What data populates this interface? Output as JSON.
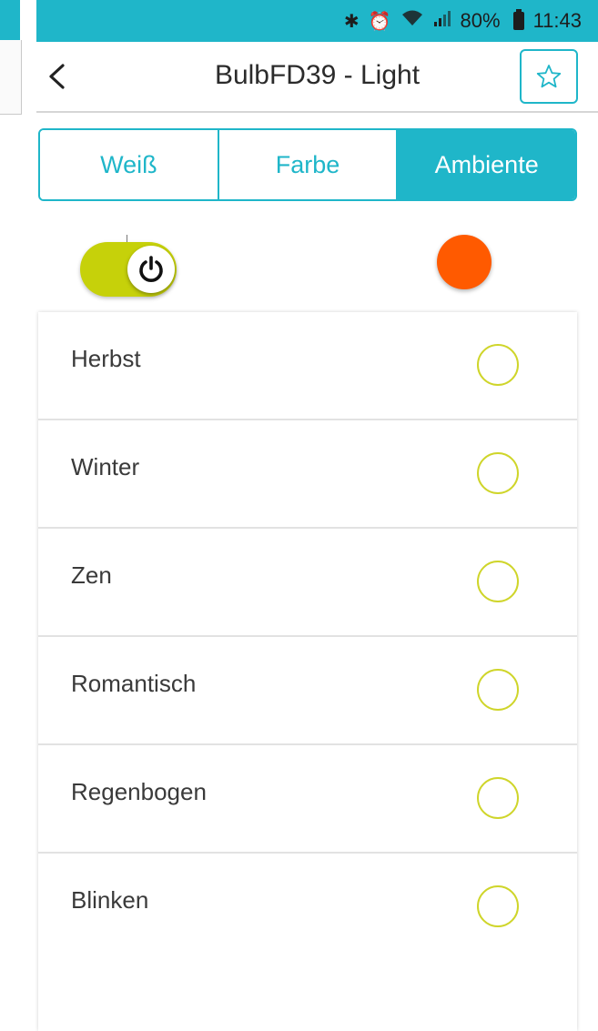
{
  "status_bar": {
    "icons": [
      "bluetooth-icon",
      "alarm-icon",
      "wifi-icon",
      "signal-icon"
    ],
    "battery": "80%",
    "time": "11:43"
  },
  "header": {
    "title": "BulbFD39 - Light",
    "back_icon": "chevron-left-icon",
    "favorite_icon": "star-outline-icon"
  },
  "tabs": [
    {
      "label": "Weiß",
      "active": false
    },
    {
      "label": "Farbe",
      "active": false
    },
    {
      "label": "Ambiente",
      "active": true
    }
  ],
  "controls": {
    "power_on": true,
    "current_color": "#ff5a00"
  },
  "scenes": [
    {
      "label": "Herbst",
      "selected": false
    },
    {
      "label": "Winter",
      "selected": false
    },
    {
      "label": "Zen",
      "selected": false
    },
    {
      "label": "Romantisch",
      "selected": false
    },
    {
      "label": "Regenbogen",
      "selected": false
    },
    {
      "label": "Blinken",
      "selected": false
    }
  ],
  "colors": {
    "accent": "#1fb6c9",
    "toggle": "#c6d10a",
    "radio": "#cfd52a"
  }
}
